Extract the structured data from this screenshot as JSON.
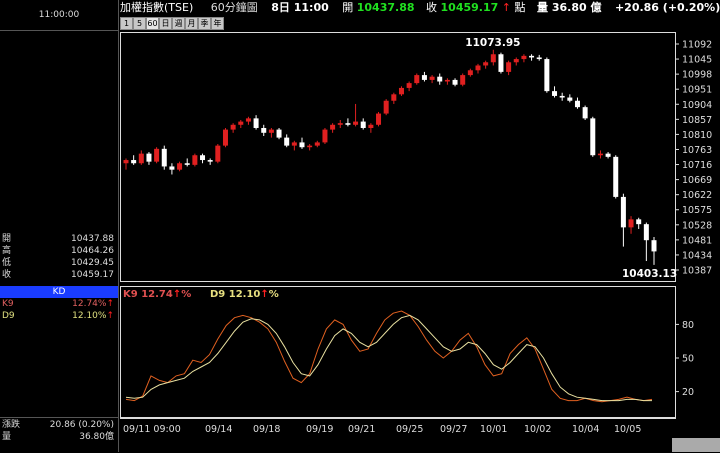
{
  "time_display": "11:00:00",
  "header": {
    "index_name": "加權指數(TSE)",
    "period_label": "60分鐘圖",
    "date_label": "8日 11:00",
    "open_label": "開",
    "open_value": "10437.88",
    "close_label": "收",
    "close_value": "10459.17",
    "arrow": "↑",
    "point_label": "點",
    "volume_label": "量 36.80 億",
    "change_text": "+20.86 (+0.20%)"
  },
  "period_buttons": [
    "1",
    "5",
    "60",
    "日",
    "週",
    "月",
    "季",
    "年"
  ],
  "ohlc": [
    {
      "label": "開",
      "value": "10437.88"
    },
    {
      "label": "高",
      "value": "10464.26"
    },
    {
      "label": "低",
      "value": "10429.45"
    },
    {
      "label": "收",
      "value": "10459.17"
    }
  ],
  "kd_panel": {
    "title": "KD",
    "k_label": "K9",
    "k_value": "12.74%",
    "d_label": "D9",
    "d_value": "12.10%",
    "arrow": "↑"
  },
  "kd_legend": {
    "k_text": "K9 12.74",
    "d_text": "D9 12.10",
    "pct": "%",
    "arrow": "↑"
  },
  "bottom_left": {
    "change_label": "漲跌",
    "change_value": "20.86 (0.20%)",
    "volume_label": "量",
    "volume_value": "36.80億"
  },
  "colors": {
    "up": "#e02020",
    "down": "#ffffff",
    "k_line": "#e06020",
    "d_line": "#e8e0a0",
    "accent_blue": "#1a3cff",
    "green": "#20e020"
  },
  "chart_data": [
    {
      "type": "candlestick",
      "y_ticks": [
        "11092",
        "11045",
        "10998",
        "10951",
        "10904",
        "10857",
        "10810",
        "10763",
        "10716",
        "10669",
        "10622",
        "10575",
        "10528",
        "10481",
        "10434",
        "10387"
      ],
      "ylim": [
        10387,
        11092
      ],
      "annotations": [
        {
          "text": "11073.95"
        },
        {
          "text": "10403.13"
        }
      ],
      "x_ticks": [
        "09/11 09:00",
        "09/14",
        "09/18",
        "09/19",
        "09/21",
        "09/25",
        "09/27",
        "10/01",
        "10/02",
        "10/04",
        "10/05"
      ],
      "candles": [
        [
          10720,
          10735,
          10700,
          10730
        ],
        [
          10730,
          10745,
          10715,
          10720
        ],
        [
          10720,
          10760,
          10715,
          10750
        ],
        [
          10750,
          10755,
          10715,
          10725
        ],
        [
          10725,
          10770,
          10720,
          10765
        ],
        [
          10765,
          10775,
          10700,
          10710
        ],
        [
          10710,
          10720,
          10685,
          10700
        ],
        [
          10700,
          10725,
          10695,
          10720
        ],
        [
          10720,
          10735,
          10710,
          10715
        ],
        [
          10715,
          10750,
          10710,
          10745
        ],
        [
          10745,
          10750,
          10720,
          10730
        ],
        [
          10730,
          10735,
          10715,
          10725
        ],
        [
          10725,
          10780,
          10720,
          10775
        ],
        [
          10775,
          10830,
          10770,
          10825
        ],
        [
          10825,
          10845,
          10815,
          10840
        ],
        [
          10840,
          10855,
          10830,
          10850
        ],
        [
          10850,
          10865,
          10840,
          10860
        ],
        [
          10860,
          10870,
          10825,
          10830
        ],
        [
          10830,
          10840,
          10805,
          10815
        ],
        [
          10815,
          10830,
          10800,
          10825
        ],
        [
          10825,
          10830,
          10795,
          10800
        ],
        [
          10800,
          10810,
          10770,
          10775
        ],
        [
          10775,
          10790,
          10760,
          10785
        ],
        [
          10785,
          10800,
          10765,
          10770
        ],
        [
          10770,
          10780,
          10760,
          10775
        ],
        [
          10775,
          10790,
          10770,
          10785
        ],
        [
          10785,
          10830,
          10780,
          10825
        ],
        [
          10825,
          10845,
          10815,
          10840
        ],
        [
          10840,
          10855,
          10830,
          10845
        ],
        [
          10845,
          10860,
          10835,
          10840
        ],
        [
          10840,
          10905,
          10835,
          10850
        ],
        [
          10850,
          10860,
          10825,
          10830
        ],
        [
          10830,
          10845,
          10815,
          10840
        ],
        [
          10840,
          10880,
          10835,
          10875
        ],
        [
          10875,
          10920,
          10870,
          10915
        ],
        [
          10915,
          10940,
          10905,
          10935
        ],
        [
          10935,
          10960,
          10930,
          10955
        ],
        [
          10955,
          10975,
          10945,
          10970
        ],
        [
          10970,
          11000,
          10965,
          10995
        ],
        [
          10995,
          11005,
          10975,
          10980
        ],
        [
          10980,
          10995,
          10970,
          10990
        ],
        [
          10990,
          11000,
          10965,
          10975
        ],
        [
          10975,
          10985,
          10965,
          10980
        ],
        [
          10980,
          10985,
          10960,
          10965
        ],
        [
          10965,
          11000,
          10960,
          10995
        ],
        [
          10995,
          11015,
          10990,
          11010
        ],
        [
          11010,
          11030,
          11000,
          11025
        ],
        [
          11025,
          11040,
          11015,
          11035
        ],
        [
          11035,
          11074,
          11025,
          11060
        ],
        [
          11060,
          11065,
          11000,
          11005
        ],
        [
          11005,
          11040,
          10995,
          11035
        ],
        [
          11035,
          11050,
          11025,
          11045
        ],
        [
          11045,
          11060,
          11035,
          11055
        ],
        [
          11055,
          11060,
          11040,
          11050
        ],
        [
          11050,
          11058,
          11040,
          11045
        ],
        [
          11045,
          11050,
          10940,
          10945
        ],
        [
          10945,
          10960,
          10925,
          10930
        ],
        [
          10930,
          10940,
          10915,
          10925
        ],
        [
          10925,
          10935,
          10910,
          10915
        ],
        [
          10915,
          10925,
          10890,
          10895
        ],
        [
          10895,
          10900,
          10855,
          10860
        ],
        [
          10860,
          10865,
          10740,
          10745
        ],
        [
          10745,
          10760,
          10735,
          10750
        ],
        [
          10750,
          10755,
          10735,
          10740
        ],
        [
          10740,
          10745,
          10610,
          10615
        ],
        [
          10615,
          10625,
          10460,
          10520
        ],
        [
          10520,
          10555,
          10500,
          10545
        ],
        [
          10545,
          10550,
          10515,
          10530
        ],
        [
          10530,
          10535,
          10415,
          10480
        ],
        [
          10480,
          10490,
          10403,
          10445
        ]
      ]
    },
    {
      "type": "line",
      "yticks": [
        80,
        50,
        20
      ],
      "ylim": [
        0,
        100
      ],
      "series": [
        {
          "name": "K9",
          "values": [
            13,
            12,
            16,
            34,
            30,
            28,
            34,
            36,
            48,
            46,
            53,
            67,
            79,
            86,
            88,
            86,
            82,
            76,
            64,
            47,
            32,
            28,
            36,
            58,
            76,
            84,
            80,
            66,
            56,
            58,
            72,
            84,
            90,
            92,
            88,
            78,
            66,
            56,
            50,
            56,
            66,
            72,
            60,
            44,
            34,
            36,
            54,
            62,
            68,
            58,
            40,
            22,
            14,
            12,
            12,
            14,
            12,
            11,
            12,
            13,
            15,
            13,
            12,
            13
          ]
        },
        {
          "name": "D9",
          "values": [
            15,
            14,
            15,
            22,
            26,
            28,
            30,
            32,
            38,
            42,
            46,
            54,
            64,
            74,
            82,
            85,
            84,
            80,
            72,
            60,
            46,
            36,
            34,
            44,
            58,
            70,
            76,
            72,
            64,
            60,
            64,
            72,
            80,
            86,
            88,
            84,
            76,
            68,
            60,
            56,
            58,
            64,
            62,
            54,
            44,
            40,
            46,
            54,
            62,
            60,
            50,
            36,
            24,
            18,
            15,
            14,
            13,
            12,
            12,
            12,
            13,
            13,
            12,
            12
          ]
        }
      ]
    }
  ]
}
